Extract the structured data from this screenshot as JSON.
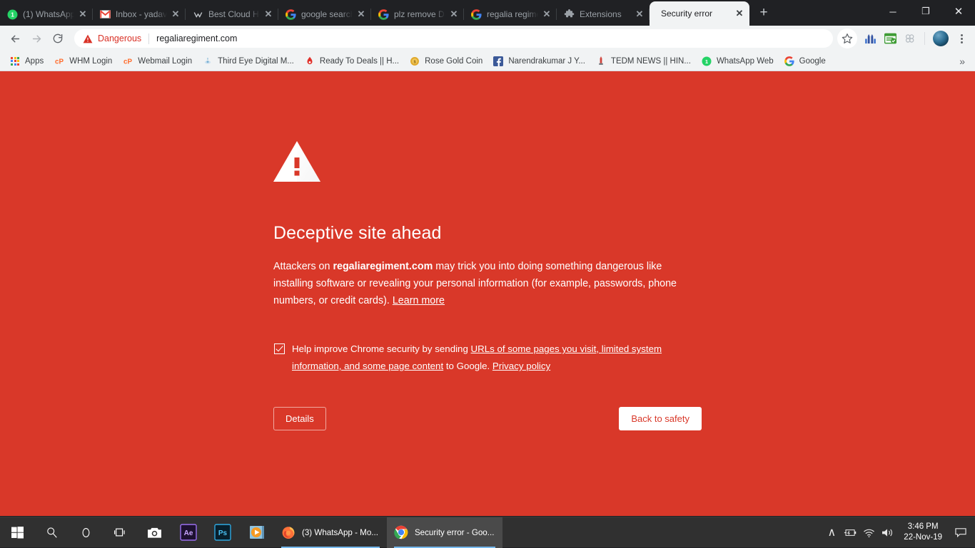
{
  "browser": {
    "tabs": [
      {
        "title": "(1) WhatsApp",
        "favicon": "whatsapp-icon",
        "active": false
      },
      {
        "title": "Inbox - yadavn",
        "favicon": "gmail-icon",
        "active": false
      },
      {
        "title": "Best Cloud Ho",
        "favicon": "generic-site-icon",
        "active": false
      },
      {
        "title": "google search",
        "favicon": "google-icon",
        "active": false
      },
      {
        "title": "plz remove Da",
        "favicon": "google-icon",
        "active": false
      },
      {
        "title": "regalia regime",
        "favicon": "google-icon",
        "active": false
      },
      {
        "title": "Extensions",
        "favicon": "puzzle-piece-icon",
        "active": false
      },
      {
        "title": "Security error",
        "favicon": "",
        "active": true
      }
    ],
    "new_tab_label": "+",
    "tab_close_label": "✕",
    "window_controls": {
      "minimize": "─",
      "maximize": "❐",
      "close": "✕"
    },
    "toolbar": {
      "back_label": "←",
      "forward_label": "→",
      "reload_label": "⟳",
      "security_status": "Dangerous",
      "url": "regaliaregiment.com",
      "icons": [
        "bookmark-star-icon",
        "analytics-extension-icon",
        "seo-extension-icon",
        "link-extension-icon"
      ],
      "menu_label": "chrome-menu-icon"
    },
    "bookmarks": [
      {
        "label": "Apps",
        "icon": "apps-grid-icon"
      },
      {
        "label": "WHM Login",
        "icon": "cpanel-icon"
      },
      {
        "label": "Webmail Login",
        "icon": "cpanel-icon"
      },
      {
        "label": "Third Eye Digital M...",
        "icon": "third-eye-icon"
      },
      {
        "label": "Ready To Deals || H...",
        "icon": "ready-to-deals-icon"
      },
      {
        "label": "Rose Gold Coin",
        "icon": "coin-icon"
      },
      {
        "label": "Narendrakumar J Y...",
        "icon": "facebook-icon"
      },
      {
        "label": "TEDM NEWS || HIN...",
        "icon": "tedm-icon"
      },
      {
        "label": "WhatsApp Web",
        "icon": "whatsapp-icon"
      },
      {
        "label": "Google",
        "icon": "google-icon"
      }
    ],
    "bookmarks_overflow_label": "»"
  },
  "interstitial": {
    "icon": "warning-triangle-icon",
    "heading": "Deceptive site ahead",
    "body_pre": "Attackers on ",
    "body_domain": "regaliaregiment.com",
    "body_post": " may trick you into doing something dangerous like installing software or revealing your personal information (for example, passwords, phone numbers, or credit cards). ",
    "learn_more": "Learn more",
    "optin": {
      "checked": true,
      "pre": "Help improve Chrome security by sending ",
      "link1": "URLs of some pages you visit, limited system information, and some page content",
      "mid": " to Google. ",
      "link2": "Privacy policy"
    },
    "details_button": "Details",
    "safety_button": "Back to safety",
    "background_color": "#d93829",
    "accent_color": "#ffffff"
  },
  "taskbar": {
    "start_label": "start-icon",
    "system_icons": [
      "start-icon",
      "search-icon",
      "cortana-icon",
      "task-view-icon",
      "camera-icon",
      "after-effects-icon",
      "photoshop-icon",
      "media-player-icon"
    ],
    "windows": [
      {
        "label": "(3) WhatsApp - Mo...",
        "icon": "firefox-icon",
        "active": false
      },
      {
        "label": "Security error - Goo...",
        "icon": "chrome-icon",
        "active": true
      }
    ],
    "tray": {
      "overflow": "∧",
      "battery": "battery-icon",
      "wifi": "wifi-icon",
      "volume": "volume-icon",
      "time": "3:46 PM",
      "date": "22-Nov-19",
      "action_center": "notifications-icon"
    }
  }
}
